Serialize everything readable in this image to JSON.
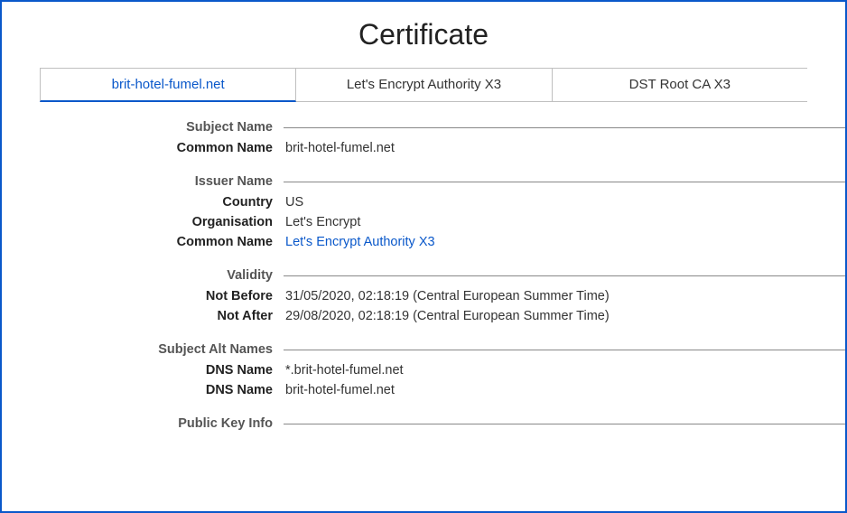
{
  "title": "Certificate",
  "tabs": [
    {
      "label": "brit-hotel-fumel.net",
      "active": true
    },
    {
      "label": "Let's Encrypt Authority X3",
      "active": false
    },
    {
      "label": "DST Root CA X3",
      "active": false
    }
  ],
  "sections": {
    "subject_name": {
      "header": "Subject Name",
      "common_name_label": "Common Name",
      "common_name_value": "brit-hotel-fumel.net"
    },
    "issuer_name": {
      "header": "Issuer Name",
      "country_label": "Country",
      "country_value": "US",
      "organisation_label": "Organisation",
      "organisation_value": "Let's Encrypt",
      "common_name_label": "Common Name",
      "common_name_value": "Let's Encrypt Authority X3"
    },
    "validity": {
      "header": "Validity",
      "not_before_label": "Not Before",
      "not_before_value": "31/05/2020, 02:18:19 (Central European Summer Time)",
      "not_after_label": "Not After",
      "not_after_value": "29/08/2020, 02:18:19 (Central European Summer Time)"
    },
    "san": {
      "header": "Subject Alt Names",
      "dns1_label": "DNS Name",
      "dns1_value": "*.brit-hotel-fumel.net",
      "dns2_label": "DNS Name",
      "dns2_value": "brit-hotel-fumel.net"
    },
    "pki": {
      "header": "Public Key Info"
    }
  }
}
